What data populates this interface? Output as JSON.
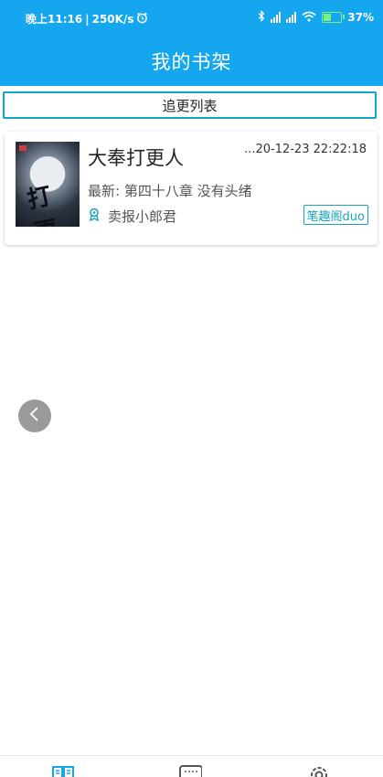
{
  "status_bar": {
    "time": "晚上11:16",
    "separator": "|",
    "net_speed": "250K/s",
    "battery": "37%",
    "battery_level": 0.37,
    "icons": [
      "alarm-icon",
      "bluetooth-icon",
      "signal-icon",
      "signal-icon",
      "wifi-icon",
      "battery-icon"
    ]
  },
  "header": {
    "title": "我的书架"
  },
  "tab_button": {
    "label": "追更列表"
  },
  "books": [
    {
      "title": "大奉打更人",
      "updated": "...20-12-23 22:22:18",
      "latest": "最新: 第四十八章 没有头绪",
      "author": "卖报小郎君",
      "source": "笔趣阁duo",
      "cover_text": "打更人"
    }
  ],
  "bottom_nav": {
    "items": [
      {
        "icon": "bookshelf-icon",
        "active": true
      },
      {
        "icon": "discover-icon",
        "active": false
      },
      {
        "icon": "settings-gear-icon",
        "active": false
      }
    ]
  },
  "colors": {
    "primary": "#14a6ee",
    "accent": "#17a2b8",
    "active_icon": "#14a6ee",
    "inactive_icon": "#555555"
  }
}
